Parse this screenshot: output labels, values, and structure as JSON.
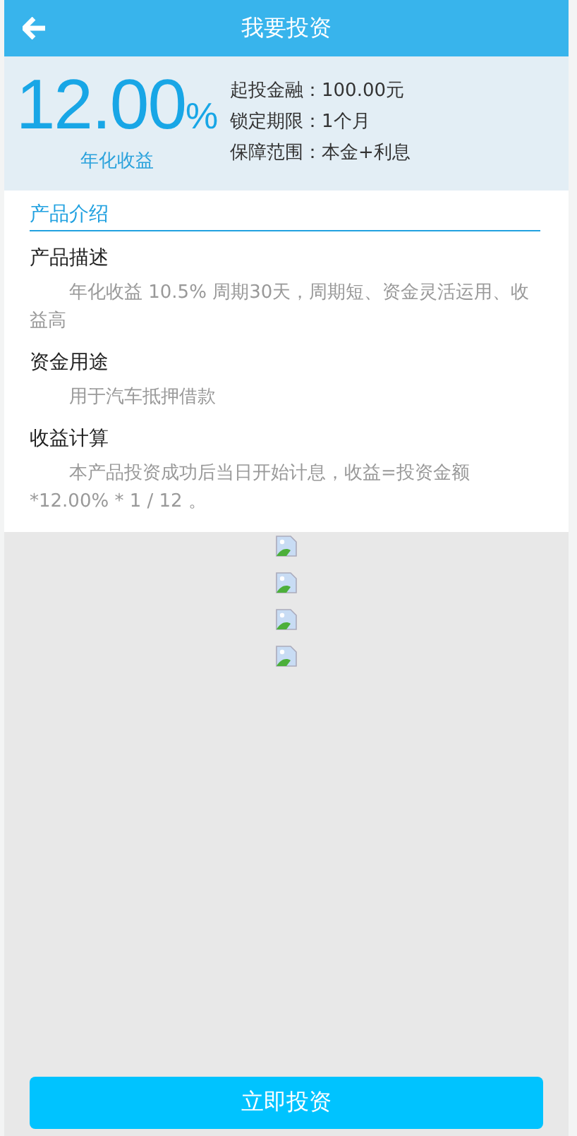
{
  "header": {
    "title": "我要投资"
  },
  "summary": {
    "rate": "12.00",
    "unit": "%",
    "rate_label": "年化收益",
    "terms": [
      {
        "label": "起投金融：",
        "value": "100.00元"
      },
      {
        "label": "锁定期限：",
        "value": "1个月"
      },
      {
        "label": "保障范围：",
        "value": "本金+利息"
      }
    ]
  },
  "intro": {
    "heading": "产品介绍",
    "sections": [
      {
        "title": "产品描述",
        "text": "年化收益 10.5% 周期30天，周期短、资金灵活运用、收益高"
      },
      {
        "title": "资金用途",
        "text": "用于汽车抵押借款"
      },
      {
        "title": "收益计算",
        "text": "本产品投资成功后当日开始计息，收益=投资金额*12.00% * 1 / 12 。"
      }
    ]
  },
  "images": [
    {
      "kind": "broken-image"
    },
    {
      "kind": "broken-image"
    },
    {
      "kind": "broken-image"
    },
    {
      "kind": "broken-image"
    }
  ],
  "action": {
    "label": "立即投资"
  }
}
